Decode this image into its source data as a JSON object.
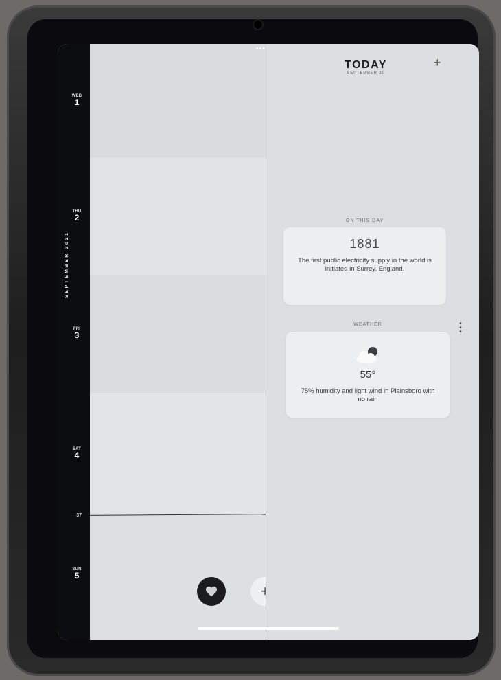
{
  "rail": {
    "month_label": "SEPTEMBER 2021",
    "week_number": "37",
    "days": [
      {
        "dow": "WED",
        "num": "1"
      },
      {
        "dow": "THU",
        "num": "2"
      },
      {
        "dow": "FRI",
        "num": "3"
      },
      {
        "dow": "SAT",
        "num": "4"
      },
      {
        "dow": "SUN",
        "num": "5"
      }
    ]
  },
  "today": {
    "title": "TODAY",
    "date": "SEPTEMBER 30",
    "add_icon": "+"
  },
  "on_this_day": {
    "heading": "ON THIS DAY",
    "year": "1881",
    "text": "The first public electricity supply in the world is initiated in Surrey, England."
  },
  "weather": {
    "heading": "WEATHER",
    "icon": "partly-cloudy-night-icon",
    "temperature": "55°",
    "summary": "75% humidity and light wind in Plainsboro with no rain"
  },
  "buttons": {
    "favorite_icon": "heart-icon",
    "add_icon": "+"
  },
  "colors": {
    "rail_bg": "#0c0d10",
    "screen_bg": "#dfe1e3",
    "card_bg": "#eceef0"
  }
}
